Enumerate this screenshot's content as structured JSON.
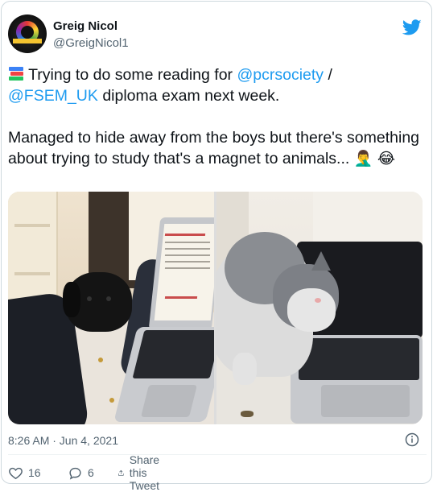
{
  "user": {
    "display_name": "Greig Nicol",
    "handle": "@GreigNicol1"
  },
  "icons": {
    "brand": "twitter-bird-icon",
    "info": "info-icon",
    "like": "heart-icon",
    "reply": "speech-bubble-icon",
    "share": "share-upload-icon"
  },
  "colors": {
    "accent": "#1d9bf0",
    "text": "#0f1419",
    "muted": "#536471"
  },
  "tweet": {
    "line1_prefix": " Trying to do some reading for ",
    "mention1": "@pcrsociety",
    "line1_suffix": " /",
    "mention2": "@FSEM_UK",
    "line2_suffix": " diploma exam next week.",
    "paragraph2": "Managed to hide away from the boys but there's something about trying to study that's a magnet to animals...",
    "emoji_books": "books",
    "emoji_facepalm": "🤦‍♂️",
    "emoji_laugh": "😂"
  },
  "media": {
    "photos": [
      {
        "subject": "black puppy beside laptop"
      },
      {
        "subject": "grey and white cat at laptop"
      }
    ]
  },
  "meta": {
    "timestamp": "8:26 AM · Jun 4, 2021"
  },
  "actions": {
    "like_count": "16",
    "reply_count": "6",
    "share_label": "Share this Tweet"
  }
}
